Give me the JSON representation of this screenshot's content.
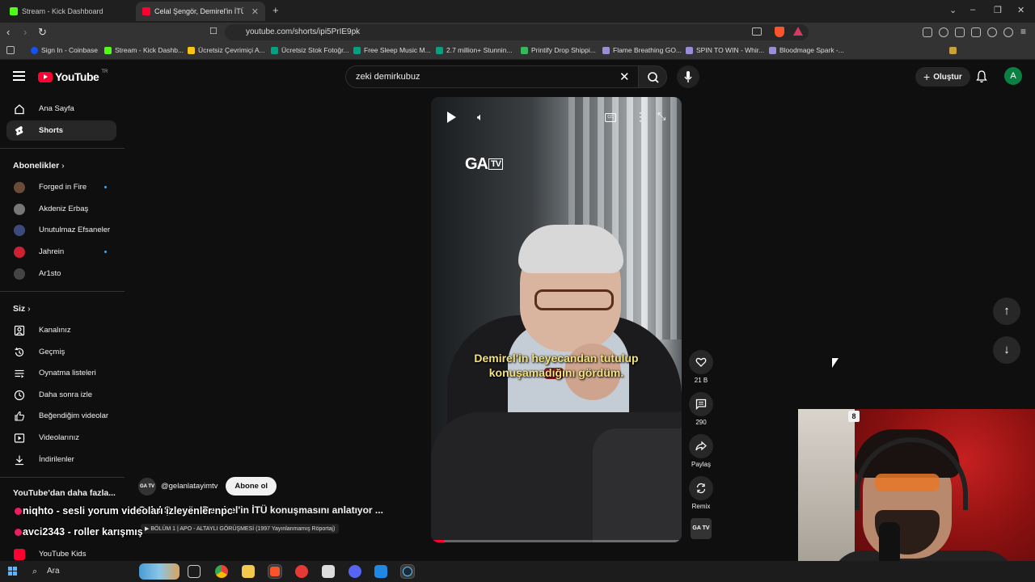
{
  "browser": {
    "tabs": [
      {
        "title": "Stream - Kick Dashboard",
        "favicon_color": "#53fc18"
      },
      {
        "title": "Celal Şengör, Demirel'in İTÜ k",
        "favicon_color": "#ff0033"
      }
    ],
    "new_tab": "+",
    "url": "youtube.com/shorts/ipi5PrIE9pk",
    "bookmarks": [
      {
        "label": "Sign In - Coinbase",
        "color": "#1652f0"
      },
      {
        "label": "Stream - Kick Dashb...",
        "color": "#53fc18"
      },
      {
        "label": "Ücretsiz Çevrimiçi A...",
        "color": "#f9c513"
      },
      {
        "label": "Ücretsiz Stok Fotoğr...",
        "color": "#05a081"
      },
      {
        "label": "Free Sleep Music M...",
        "color": "#05a081"
      },
      {
        "label": "2.7 million+ Stunnin...",
        "color": "#05a081"
      },
      {
        "label": "Printify Drop Shippi...",
        "color": "#39b75d"
      },
      {
        "label": "Flame Breathing GO...",
        "color": "#9b8cd8"
      },
      {
        "label": "SPIN TO WIN - Whir...",
        "color": "#9b8cd8"
      },
      {
        "label": "Bloodmage Spark -...",
        "color": "#9b8cd8"
      }
    ]
  },
  "youtube": {
    "logo_text": "YouTube",
    "country_code": "TR",
    "search_value": "zeki demirkubuz",
    "create_label": "Oluştur",
    "avatar_letter": "A"
  },
  "sidebar": {
    "main": [
      {
        "label": "Ana Sayfa",
        "icon": "home-icon"
      },
      {
        "label": "Shorts",
        "icon": "shorts-icon",
        "active": true
      }
    ],
    "subscriptions_heading": "Abonelikler",
    "subscriptions": [
      {
        "label": "Forged in Fire",
        "new": true,
        "color": "#6b4a3a"
      },
      {
        "label": "Akdeniz Erbaş",
        "new": false,
        "color": "#777"
      },
      {
        "label": "Unutulmaz Efsaneler",
        "new": false,
        "color": "#3a4a7a"
      },
      {
        "label": "Jahrein",
        "new": true,
        "color": "#c23"
      },
      {
        "label": "Ar1sto",
        "new": false,
        "color": "#444"
      }
    ],
    "you_heading": "Siz",
    "you": [
      {
        "label": "Kanalınız",
        "icon": "channel-icon"
      },
      {
        "label": "Geçmiş",
        "icon": "history-icon"
      },
      {
        "label": "Oynatma listeleri",
        "icon": "playlists-icon"
      },
      {
        "label": "Daha sonra izle",
        "icon": "watch-later-icon"
      },
      {
        "label": "Beğendiğim videolar",
        "icon": "like-icon"
      },
      {
        "label": "Videolarınız",
        "icon": "your-videos-icon"
      },
      {
        "label": "İndirilenler",
        "icon": "downloads-icon"
      }
    ],
    "more_heading": "YouTube'dan daha fazla...",
    "more": [
      {
        "label": "YouTube Kids",
        "icon": "youtube-kids-icon"
      }
    ]
  },
  "short": {
    "watermark": "GA",
    "watermark_tv": "TV",
    "subtitle": "Demirel'in heyecandan tutulup konuşamadığını gördüm.",
    "progress_fraction": 0.05,
    "channel": "@gelanlatayimtv",
    "channel_avatar_text": "GA TV",
    "subscribe_label": "Abone ol",
    "title": "Celal Şengör, Demirel'in İTÜ konuşmasını anlatıyor ...",
    "related": "BÖLÜM 1 | APO - ALTAYLI GÖRÜŞMESİ (1997 Yayınlanmamış Röportaj)",
    "likes": "21 B",
    "comments": "290",
    "share_label": "Paylaş",
    "remix_label": "Remix",
    "sound_thumb_text": "GA TV"
  },
  "chat": [
    {
      "user": "niqhto",
      "message": "sesli yorum videoları izleyenler npc"
    },
    {
      "user": "avci2343",
      "message": "roller karışmış"
    }
  ],
  "taskbar": {
    "search_placeholder": "Ara"
  },
  "webcam": {
    "overlay_number": "8"
  }
}
